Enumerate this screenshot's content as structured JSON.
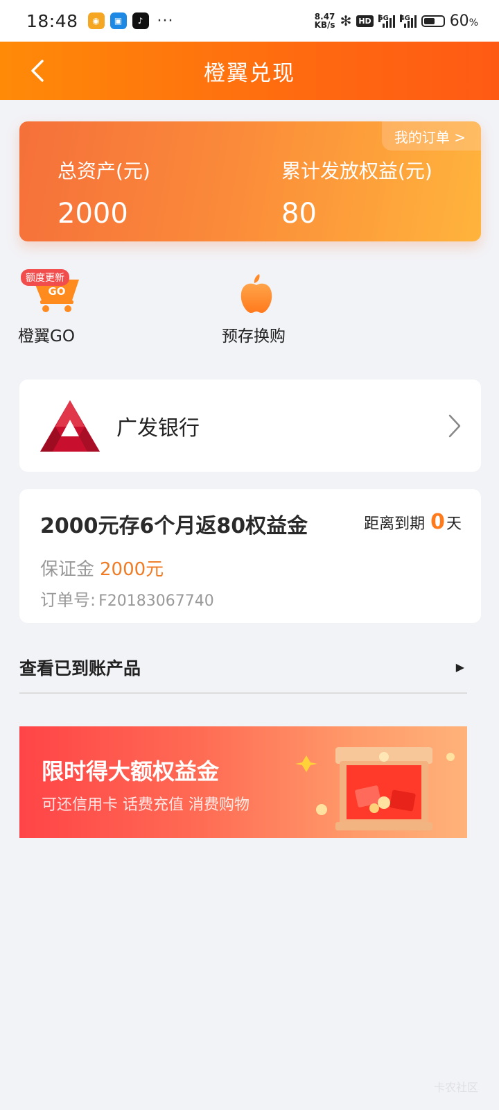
{
  "status_bar": {
    "time": "18:48",
    "more": "···",
    "net_speed_value": "8.47",
    "net_speed_unit": "KB/s",
    "hd": "HD",
    "sig1_tag": "5G",
    "sig2_tag": "4G",
    "battery_pct": "60",
    "battery_pct_unit": "%",
    "battery_level": 0.6
  },
  "header": {
    "title": "橙翼兑现",
    "back_icon": "chevron-left-icon"
  },
  "asset_card": {
    "my_order": "我的订单 >",
    "total_label": "总资产(元)",
    "total_value": "2000",
    "benefit_label": "累计发放权益(元)",
    "benefit_value": "80"
  },
  "entries": {
    "go_badge": "额度更新",
    "go_cart_text": "GO",
    "go_label": "橙翼GO",
    "apple_label": "预存换购"
  },
  "bank": {
    "name": "广发银行"
  },
  "product": {
    "title": "2000元存6个月返80权益金",
    "expire_prefix": "距离到期",
    "expire_days": "0",
    "expire_unit": "天",
    "deposit_label": "保证金",
    "deposit_amount": "2000元",
    "order_label": "订单号:",
    "order_no": "F20183067740"
  },
  "arrived": {
    "label": "查看已到账产品"
  },
  "promo": {
    "title": "限时得大额权益金",
    "subtitle": "可还信用卡 话费充值 消费购物"
  },
  "colors": {
    "header_orange": "#ff6a10",
    "accent_orange": "#f07b25",
    "bank_red": "#c8102e",
    "promo_red": "#ff4447"
  }
}
